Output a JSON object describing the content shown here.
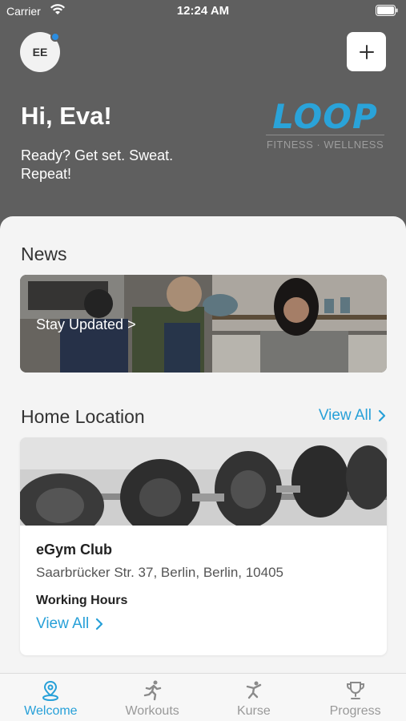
{
  "status": {
    "carrier": "Carrier",
    "time": "12:24 AM"
  },
  "profile": {
    "initials": "EE"
  },
  "greeting": "Hi, Eva!",
  "tagline": "Ready? Get set. Sweat. Repeat!",
  "logo": {
    "word": "LOOP",
    "subtitle": "FITNESS · WELLNESS"
  },
  "news": {
    "title": "News",
    "link": "Stay Updated >"
  },
  "home": {
    "title": "Home Location",
    "view_all": "View All",
    "club_name": "eGym Club",
    "address": "Saarbrücker Str. 37, Berlin, Berlin, 10405",
    "hours_label": "Working Hours",
    "hours_view_all": "View All"
  },
  "tabs": [
    {
      "label": "Welcome",
      "icon": "location-pin-icon",
      "active": true
    },
    {
      "label": "Workouts",
      "icon": "running-icon",
      "active": false
    },
    {
      "label": "Kurse",
      "icon": "dancing-icon",
      "active": false
    },
    {
      "label": "Progress",
      "icon": "trophy-icon",
      "active": false
    }
  ],
  "colors": {
    "accent": "#27A0D8",
    "header": "#5F5F5F",
    "notification_dot": "#2B8DE0"
  }
}
